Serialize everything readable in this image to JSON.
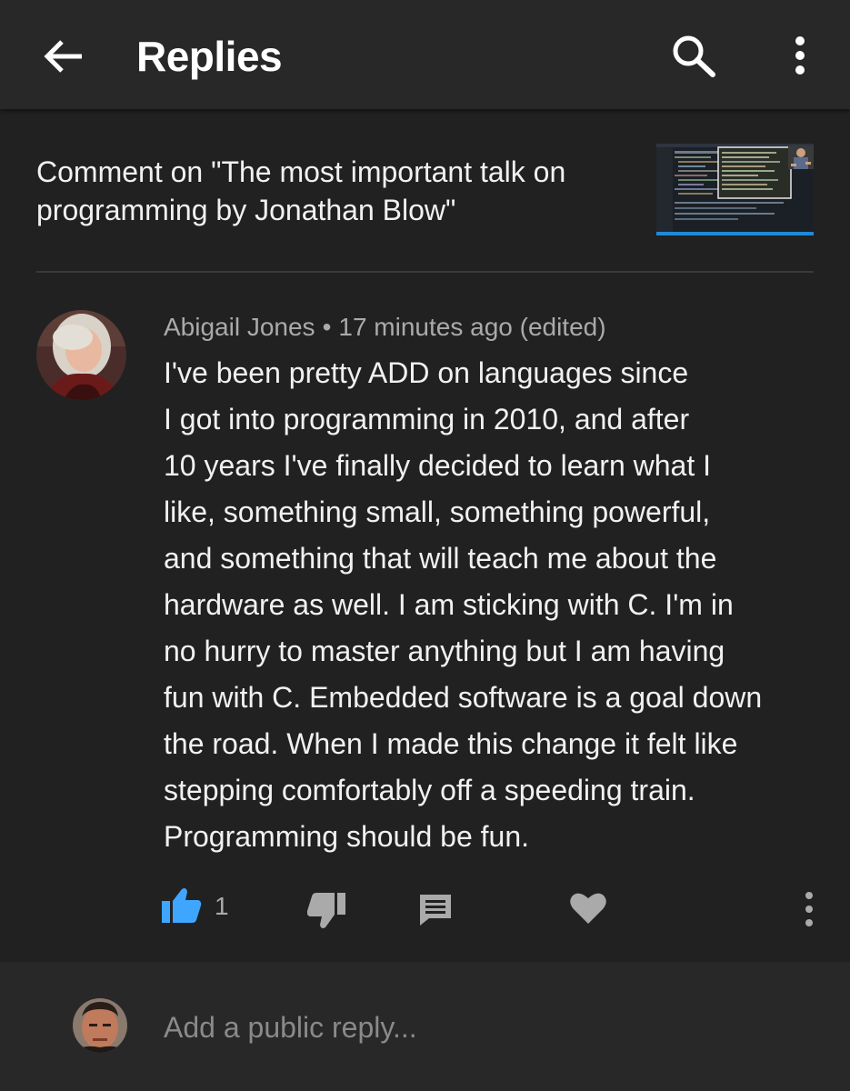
{
  "appbar": {
    "title": "Replies",
    "back_icon": "arrow-left-icon",
    "search_icon": "search-icon",
    "more_icon": "more-vertical-icon"
  },
  "context": {
    "title": "Comment on \"The most important talk on programming by Jonathan Blow\"",
    "title_lines": [
      "Comment on \"The most important talk on",
      "programming by Jonathan Blow\""
    ]
  },
  "comment": {
    "author": "Abigail Jones",
    "separator": "•",
    "time": "17 minutes ago (edited)",
    "body_lines": [
      "I've been pretty ADD on languages since",
      "I got into programming in 2010, and after",
      "10 years I've finally decided to learn what I",
      "like, something small, something powerful,",
      "and something that will teach me about the",
      "hardware as well. I am sticking with C. I'm in",
      "no hurry to master anything but I am having",
      "fun with C. Embedded software is a goal down",
      "the road. When I made this change it felt like",
      "stepping comfortably off a speeding train.",
      "Programming should be fun."
    ],
    "like_count": "1"
  },
  "actions": {
    "icons": [
      "thumbs-up-icon",
      "thumbs-down-icon",
      "reply-icon",
      "heart-icon",
      "more-vertical-icon"
    ],
    "like_color": "#3ea6ff",
    "icon_color": "#aaaaaa"
  },
  "reply": {
    "placeholder": "Add a public reply..."
  }
}
